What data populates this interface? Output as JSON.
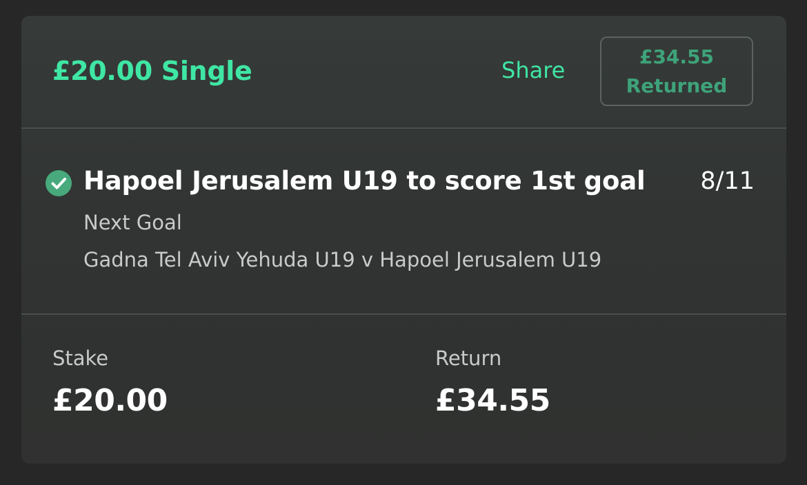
{
  "bet": {
    "title": "£20.00 Single",
    "share_label": "Share",
    "returned_amount": "£34.55",
    "returned_label": "Returned"
  },
  "selection": {
    "name": "Hapoel Jerusalem U19 to score 1st goal",
    "odds": "8/11",
    "market": "Next Goal",
    "event": "Gadna Tel Aviv Yehuda U19 v Hapoel Jerusalem U19",
    "status_icon": "check-circle-icon"
  },
  "summary": {
    "stake_label": "Stake",
    "stake_value": "£20.00",
    "return_label": "Return",
    "return_value": "£34.55"
  },
  "colors": {
    "background": "#272727",
    "card": "#333635",
    "accent": "#3fe6a4",
    "badge_text": "#3ea37a",
    "check": "#47a97c"
  }
}
